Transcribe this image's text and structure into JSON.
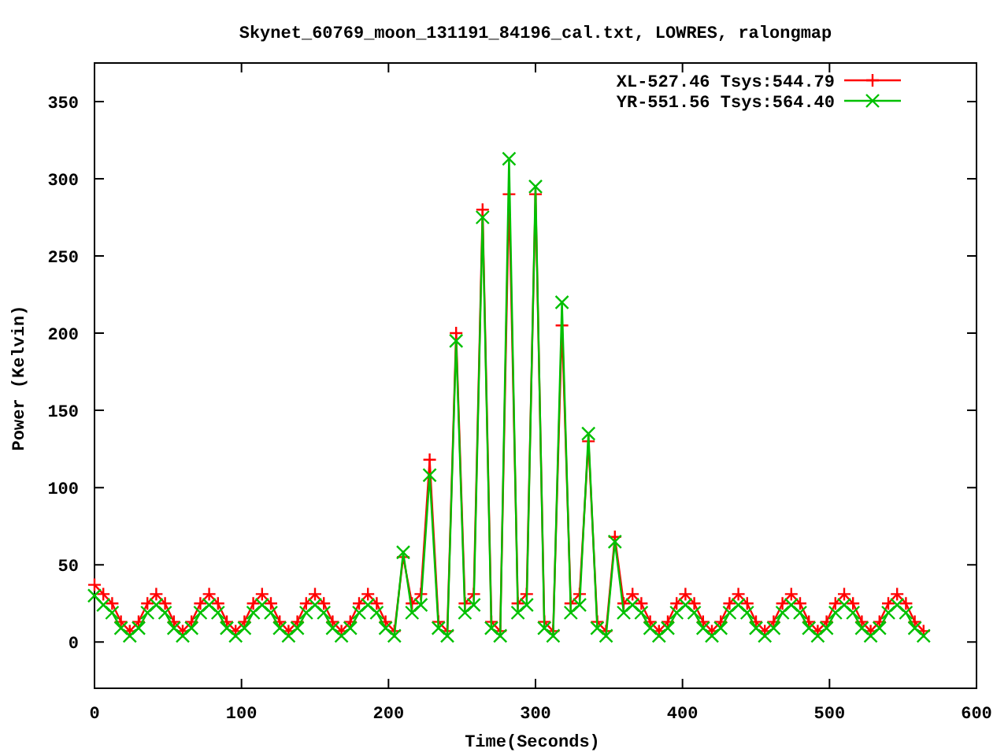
{
  "plot": {
    "chart_data": {
      "type": "line",
      "title": "Skynet_60769_moon_131191_84196_cal.txt, LOWRES, ralongmap",
      "xlabel": "Time(Seconds)",
      "ylabel": "Power (Kelvin)",
      "x": [
        0,
        6,
        12,
        18,
        24,
        30,
        36,
        42,
        48,
        54,
        60,
        66,
        72,
        78,
        84,
        90,
        96,
        102,
        108,
        114,
        120,
        126,
        132,
        138,
        144,
        150,
        156,
        162,
        168,
        174,
        180,
        186,
        192,
        198,
        204,
        210,
        216,
        222,
        228,
        234,
        240,
        246,
        252,
        258,
        264,
        270,
        276,
        282,
        288,
        294,
        300,
        306,
        312,
        318,
        324,
        330,
        336,
        342,
        348,
        354,
        360,
        366,
        372,
        378,
        384,
        390,
        396,
        402,
        408,
        414,
        420,
        426,
        432,
        438,
        444,
        450,
        456,
        462,
        468,
        474,
        480,
        486,
        492,
        498,
        504,
        510,
        516,
        522,
        528,
        534,
        540,
        546,
        552,
        558,
        564
      ],
      "series": [
        {
          "name": "XL-527.46 Tsys:544.79",
          "color": "#ff0000",
          "marker": "cross",
          "values": [
            37,
            31,
            25,
            13,
            7,
            13,
            25,
            31,
            25,
            13,
            7,
            13,
            25,
            31,
            25,
            13,
            7,
            13,
            25,
            31,
            25,
            13,
            7,
            13,
            25,
            31,
            25,
            13,
            7,
            13,
            25,
            31,
            25,
            13,
            7,
            55,
            25,
            31,
            118,
            13,
            7,
            200,
            25,
            31,
            280,
            13,
            7,
            290,
            25,
            31,
            290,
            13,
            7,
            205,
            25,
            31,
            130,
            13,
            7,
            68,
            25,
            31,
            25,
            13,
            7,
            13,
            25,
            31,
            25,
            13,
            7,
            13,
            25,
            31,
            25,
            13,
            7,
            13,
            25,
            31,
            25,
            13,
            7,
            13,
            25,
            31,
            25,
            13,
            7,
            13,
            25,
            31,
            25,
            13,
            7
          ]
        },
        {
          "name": "YR-551.56 Tsys:564.40",
          "color": "#00c000",
          "marker": "cross",
          "values": [
            30,
            24,
            19,
            9,
            4,
            9,
            19,
            24,
            19,
            9,
            4,
            9,
            19,
            24,
            19,
            9,
            4,
            9,
            19,
            24,
            19,
            9,
            4,
            9,
            19,
            24,
            19,
            9,
            4,
            9,
            19,
            24,
            19,
            9,
            4,
            58,
            19,
            24,
            108,
            9,
            4,
            195,
            19,
            24,
            275,
            9,
            4,
            313,
            19,
            24,
            295,
            9,
            4,
            220,
            19,
            24,
            135,
            9,
            4,
            65,
            19,
            24,
            19,
            9,
            4,
            9,
            19,
            24,
            19,
            9,
            4,
            9,
            19,
            24,
            19,
            9,
            4,
            9,
            19,
            24,
            19,
            9,
            4,
            9,
            19,
            24,
            19,
            9,
            4,
            9,
            19,
            24,
            19,
            9,
            4
          ]
        }
      ],
      "legend": true,
      "xlim": [
        0,
        600
      ],
      "ylim": [
        -30,
        375
      ],
      "xticks": [
        0,
        100,
        200,
        300,
        400,
        500,
        600
      ],
      "yticks": [
        0,
        50,
        100,
        150,
        200,
        250,
        300,
        350
      ]
    }
  }
}
